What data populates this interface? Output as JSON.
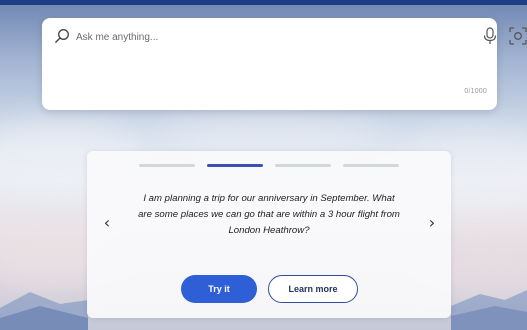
{
  "search": {
    "placeholder": "Ask me anything...",
    "char_count": "0/1000"
  },
  "icons": {
    "search": "search-icon",
    "mic": "mic-icon",
    "scan": "visual-search-icon",
    "prev": "chevron-left-icon",
    "next": "chevron-right-icon"
  },
  "suggestion": {
    "active_index": 1,
    "total": 4,
    "prev_glyph": "‹",
    "next_glyph": "›",
    "prompt": "I am planning a trip for our anniversary in September. What are some places we can go that are within a 3 hour flight from London Heathrow?",
    "try_label": "Try it",
    "learn_label": "Learn more"
  },
  "colors": {
    "accent": "#2f5fd6",
    "progress_active": "#3a4fb8",
    "progress_inactive": "#d3d6dd"
  }
}
